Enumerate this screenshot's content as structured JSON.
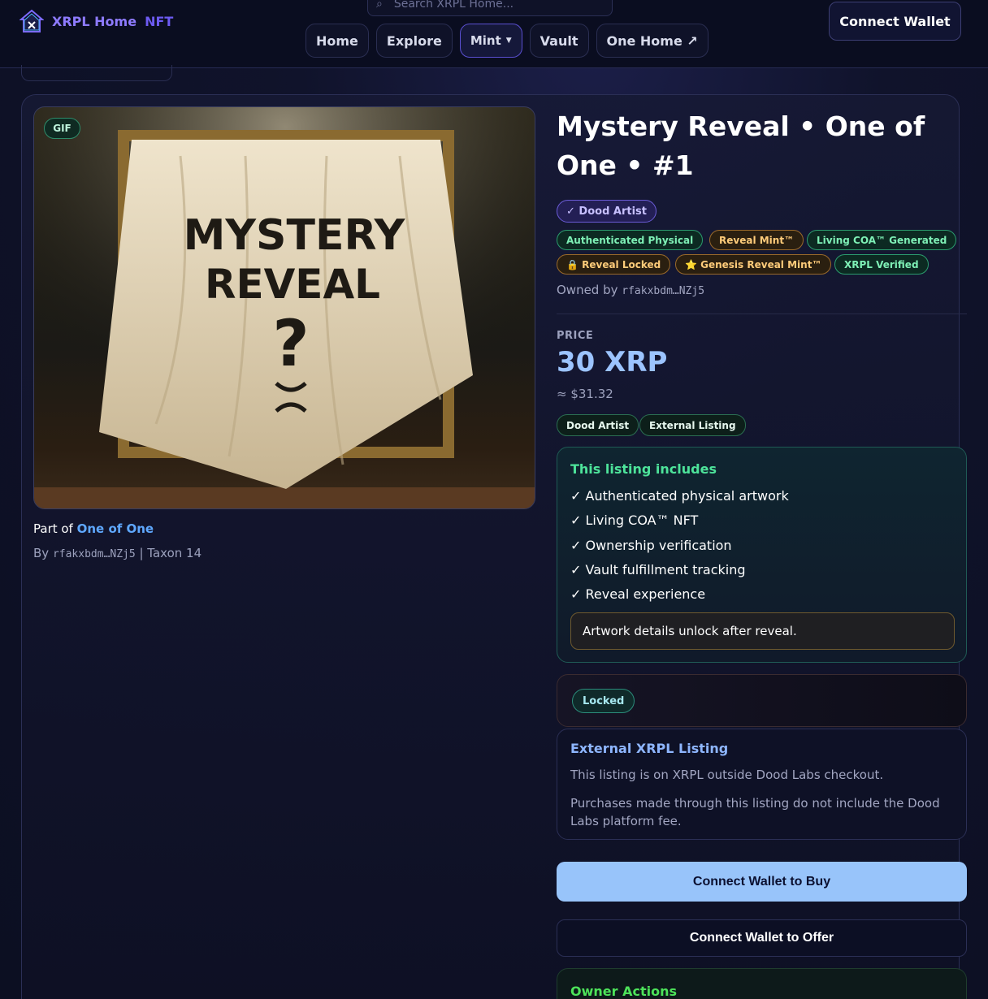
{
  "header": {
    "brand": "XRPL Home",
    "brand_suffix": "NFT",
    "search_placeholder": "Search XRPL Home...",
    "nav": [
      {
        "label": "Home"
      },
      {
        "label": "Explore"
      },
      {
        "label": "Mint"
      },
      {
        "label": "Vault"
      },
      {
        "label": "One Home ↗"
      }
    ],
    "connect_label": "Connect Wallet"
  },
  "media": {
    "badge": "GIF",
    "art_text_line1": "MYSTERY",
    "art_text_line2": "REVEAL",
    "art_text_q": "?"
  },
  "collection": {
    "part_of_prefix": "Part of",
    "name": "One of One",
    "by_prefix": "By",
    "creator": "rfakxbdm…NZj5",
    "taxon": "| Taxon 14"
  },
  "nft": {
    "title": "Mystery Reveal • One of One • #1",
    "artist_badge": "✓ Dood Artist",
    "tags": [
      {
        "label": "Authenticated Physical",
        "style": "green"
      },
      {
        "label": "Reveal Mint™",
        "style": "orange"
      },
      {
        "label": "Living COA™ Generated",
        "style": "green"
      },
      {
        "label": "🔒 Reveal Locked",
        "style": "orange"
      },
      {
        "label": "⭐ Genesis Reveal Mint™",
        "style": "orange"
      },
      {
        "label": "XRPL Verified",
        "style": "green"
      }
    ],
    "owned_prefix": "Owned by",
    "owner": "rfakxbdm…NZj5"
  },
  "pricing": {
    "label": "PRICE",
    "amount": "30 XRP",
    "usd": "≈ $31.32",
    "source_tags": [
      "Dood Artist",
      "External Listing"
    ]
  },
  "includes": {
    "title": "This listing includes",
    "items": [
      "✓ Authenticated physical artwork",
      "✓ Living COA™ NFT",
      "✓ Ownership verification",
      "✓ Vault fulfillment tracking",
      "✓ Reveal experience"
    ],
    "notice": "Artwork details unlock after reveal."
  },
  "status": {
    "locked_label": "Locked"
  },
  "external": {
    "title": "External XRPL Listing",
    "line1": "This listing is on XRPL outside Dood Labs checkout.",
    "line2": "Purchases made through this listing do not include the Dood Labs platform fee."
  },
  "actions": {
    "buy_label": "Connect Wallet to Buy",
    "offer_label": "Connect Wallet to Offer",
    "owner_title": "Owner Actions"
  },
  "colors": {
    "accent_blue": "#98c4fa",
    "accent_green": "#4de39a",
    "brand_purple": "#8e7bff",
    "background": "#0c0f22"
  }
}
